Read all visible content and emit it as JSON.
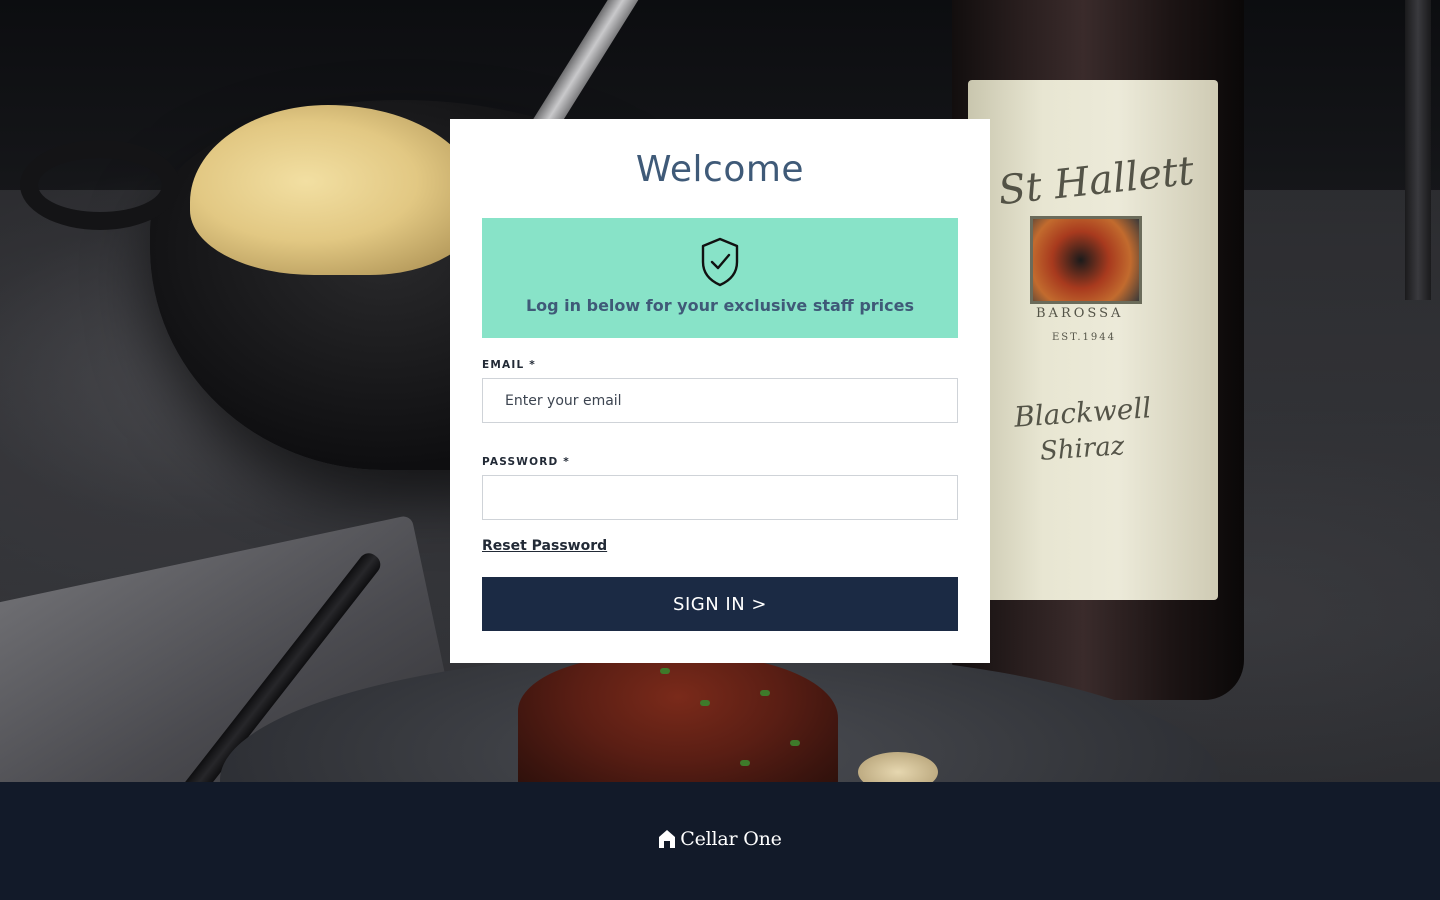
{
  "card": {
    "title": "Welcome",
    "notice": {
      "icon": "shield-check-icon",
      "text": "Log in below for your exclusive staff prices",
      "color": "#88e3c8"
    },
    "email": {
      "label": "EMAIL *",
      "placeholder": "Enter your email",
      "value": ""
    },
    "password": {
      "label": "PASSWORD *",
      "placeholder": "",
      "value": ""
    },
    "reset_link": "Reset Password",
    "signin_label": "SIGN IN >"
  },
  "footer": {
    "brand_icon": "house-icon",
    "brand_name": "Cellar One",
    "background": "#121a29"
  },
  "background_image": {
    "label_text_1": "St Hallett",
    "label_text_2": "BAROSSA",
    "label_text_3": "EST.1944",
    "label_text_4": "Blackwell",
    "label_text_5": "Shiraz"
  },
  "colors": {
    "accent_text": "#3f5a78",
    "button_bg": "#1b2a44"
  }
}
